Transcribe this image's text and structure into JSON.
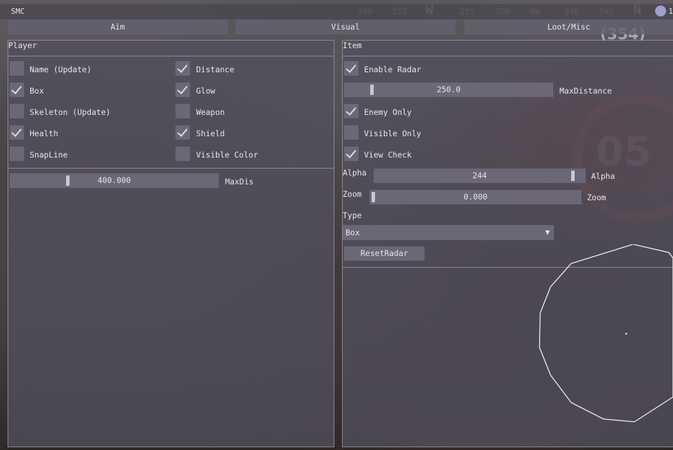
{
  "window": {
    "title": "SMC"
  },
  "tabs": [
    "Aim",
    "Visual",
    "Loot/Misc"
  ],
  "background_hud": {
    "compass": [
      "240",
      "255",
      "W",
      "285",
      "300",
      "NW",
      "330",
      "345",
      "N",
      "1"
    ],
    "heading": "(354)",
    "ring_number": "05"
  },
  "player": {
    "header": "Player",
    "options_left": [
      {
        "label": "Name (Update)",
        "checked": false
      },
      {
        "label": "Box",
        "checked": true
      },
      {
        "label": "Skeleton (Update)",
        "checked": false
      },
      {
        "label": "Health",
        "checked": true
      },
      {
        "label": "SnapLine",
        "checked": false
      }
    ],
    "options_right": [
      {
        "label": "Distance",
        "checked": true
      },
      {
        "label": "Glow",
        "checked": true
      },
      {
        "label": "Weapon",
        "checked": false
      },
      {
        "label": "Shield",
        "checked": true
      },
      {
        "label": "Visible Color",
        "checked": false
      }
    ],
    "maxdis": {
      "value": "400.000",
      "label": "MaxDis",
      "fraction": 0.27
    }
  },
  "item": {
    "header": "Item",
    "enable_radar": {
      "label": "Enable Radar",
      "checked": true
    },
    "max_distance": {
      "value": "250.0",
      "label": "MaxDistance",
      "fraction": 0.12
    },
    "enemy_only": {
      "label": "Enemy Only",
      "checked": true
    },
    "visible_only": {
      "label": "Visible Only",
      "checked": false
    },
    "view_check": {
      "label": "View Check",
      "checked": true
    },
    "alpha": {
      "label_left": "Alpha",
      "value": "244",
      "label_right": "Alpha",
      "fraction": 0.96
    },
    "zoom": {
      "label_left": "Zoom",
      "value": "0.000",
      "label_right": "Zoom",
      "fraction": 0.0
    },
    "type": {
      "label": "Type",
      "value": "Box"
    },
    "reset_button": "ResetRadar"
  },
  "colors": {
    "panel": "#52505e",
    "frame": "#6e6a7a",
    "text": "#e8e6ee",
    "check": "#dcdce4"
  }
}
